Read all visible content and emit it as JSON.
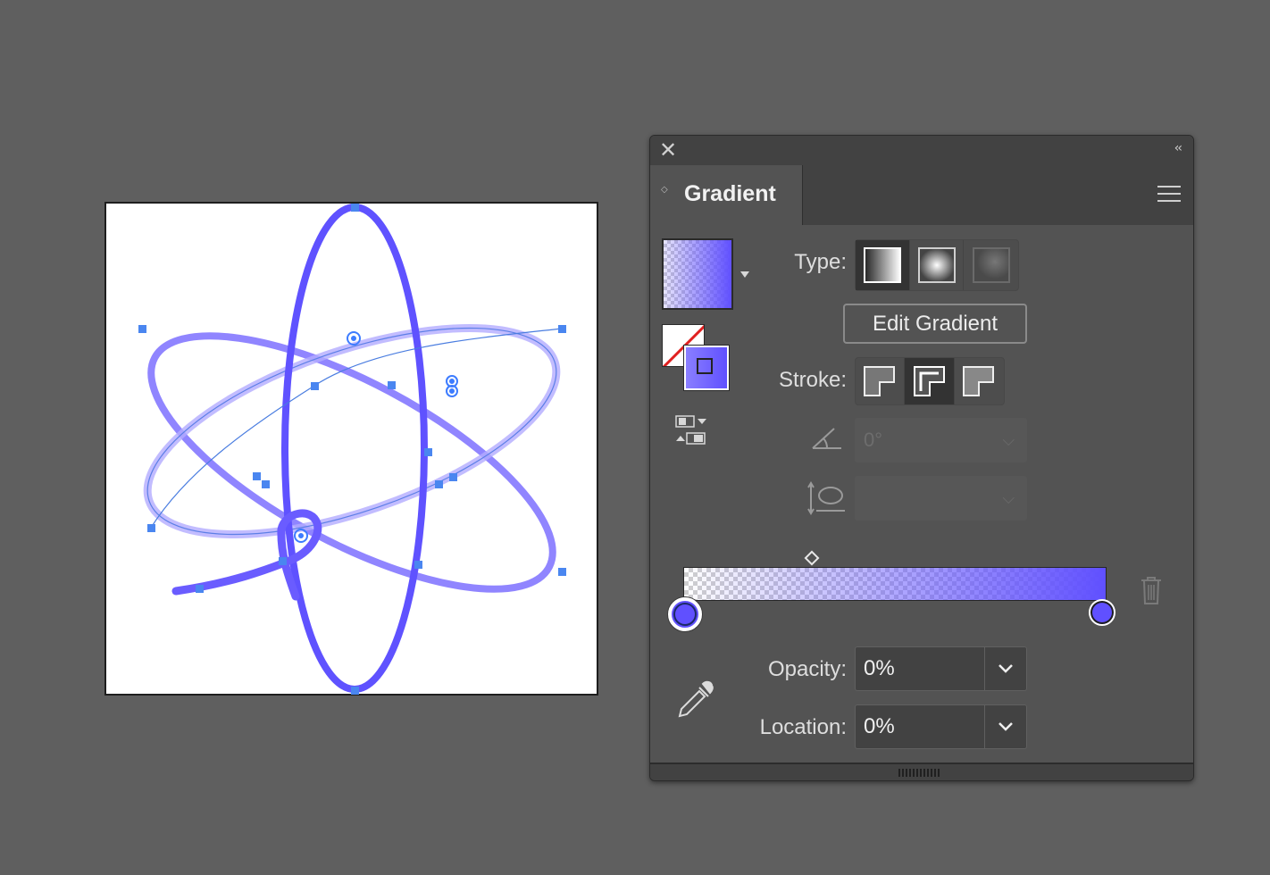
{
  "panel": {
    "tab_title": "Gradient",
    "type_label": "Type:",
    "type_options": [
      "linear-gradient",
      "radial-gradient",
      "freeform-gradient"
    ],
    "edit_gradient_label": "Edit Gradient",
    "stroke_label": "Stroke:",
    "stroke_options": [
      "within-stroke",
      "along-stroke",
      "across-stroke"
    ],
    "angle_value": "0°",
    "aspect_value": "",
    "opacity_label": "Opacity:",
    "opacity_value": "0%",
    "location_label": "Location:",
    "location_value": "0%",
    "gradient_start_color": "#ffffff",
    "gradient_end_color": "#6050ff",
    "gradient_start_opacity": 0,
    "gradient_end_opacity": 100
  },
  "colors": {
    "accent": "#6050ff",
    "selection": "#3d7cff",
    "panel_bg": "#535353",
    "canvas_bg": "#5f5f5f"
  }
}
